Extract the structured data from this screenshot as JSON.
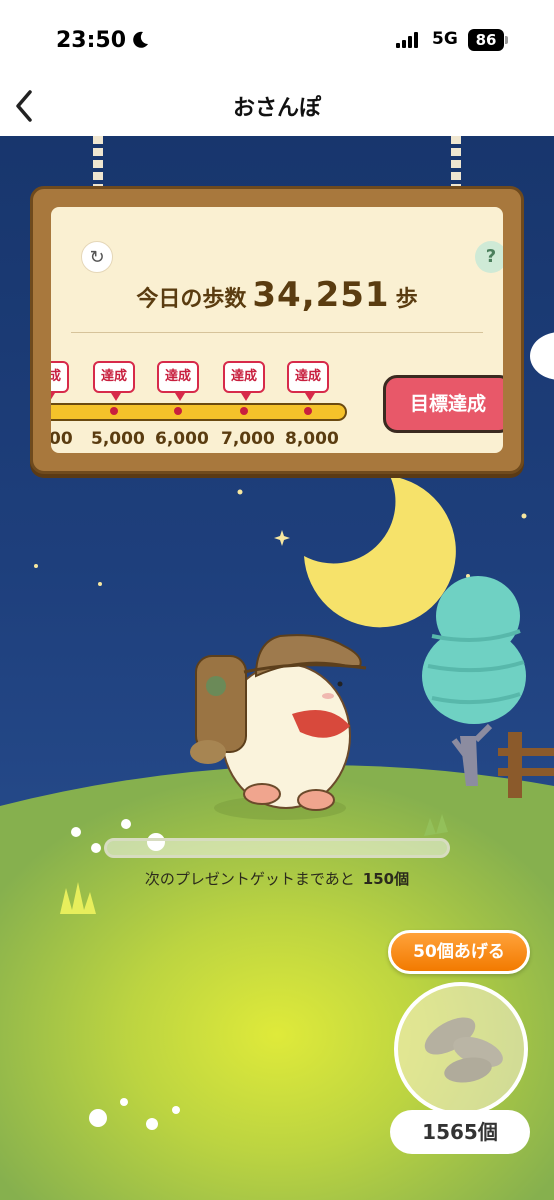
{
  "status_bar": {
    "time": "23:50",
    "network": "5G",
    "battery": "86"
  },
  "nav": {
    "title": "おさんぽ"
  },
  "board": {
    "steps_label": "今日の歩数",
    "steps_value": "34,251",
    "steps_unit": "歩",
    "milestone_badge": "達成",
    "ticks": [
      "00",
      "5,000",
      "6,000",
      "7,000",
      "8,000"
    ],
    "goal_button": "目標達成"
  },
  "present": {
    "label": "次のプレゼントゲットまであと",
    "remaining": "150個",
    "progress_fraction": 0.0
  },
  "seeds": {
    "give_button": "50個あげる",
    "count": "1565個"
  },
  "colors": {
    "sky": "#1e3f7c",
    "hill": "#a9c94a",
    "board_wood": "#a8783d",
    "accent_red": "#d72a4a",
    "progress_yellow": "#f5c22a",
    "give_orange": "#f27a00"
  }
}
